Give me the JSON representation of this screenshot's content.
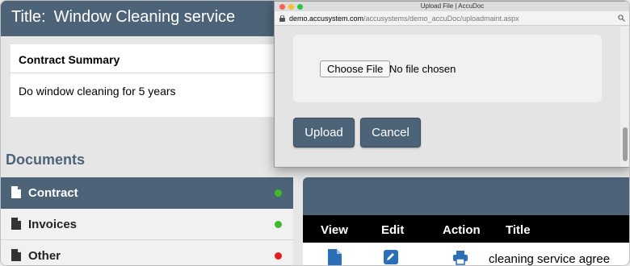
{
  "header": {
    "title_label": "Title:",
    "title_value": "Window Cleaning service"
  },
  "summary": {
    "heading": "Contract Summary",
    "text": "Do window cleaning for 5 years"
  },
  "documents": {
    "heading": "Documents",
    "items": [
      {
        "label": "Contract",
        "status_color": "#3dbb2a",
        "active": true
      },
      {
        "label": "Invoices",
        "status_color": "#3dbb2a",
        "active": false
      },
      {
        "label": "Other",
        "status_color": "#e02020",
        "active": false
      }
    ]
  },
  "table": {
    "columns": [
      "View",
      "Edit",
      "Action",
      "Title"
    ],
    "rows": [
      {
        "title": "cleaning service agree"
      }
    ]
  },
  "popup": {
    "window_title": "Upload File | AccuDoc",
    "url_host": "demo.accusystem.com",
    "url_path": "/accusystems/demo_accuDoc/uploadmaint.aspx",
    "choose_file_label": "Choose File",
    "file_status": "No file chosen",
    "upload_label": "Upload",
    "cancel_label": "Cancel"
  },
  "colors": {
    "brand": "#4d6478",
    "link_icon": "#2a6fb8"
  },
  "icons": [
    "file-icon",
    "pencil-icon",
    "printer-icon",
    "lock-icon",
    "zoom-icon"
  ]
}
